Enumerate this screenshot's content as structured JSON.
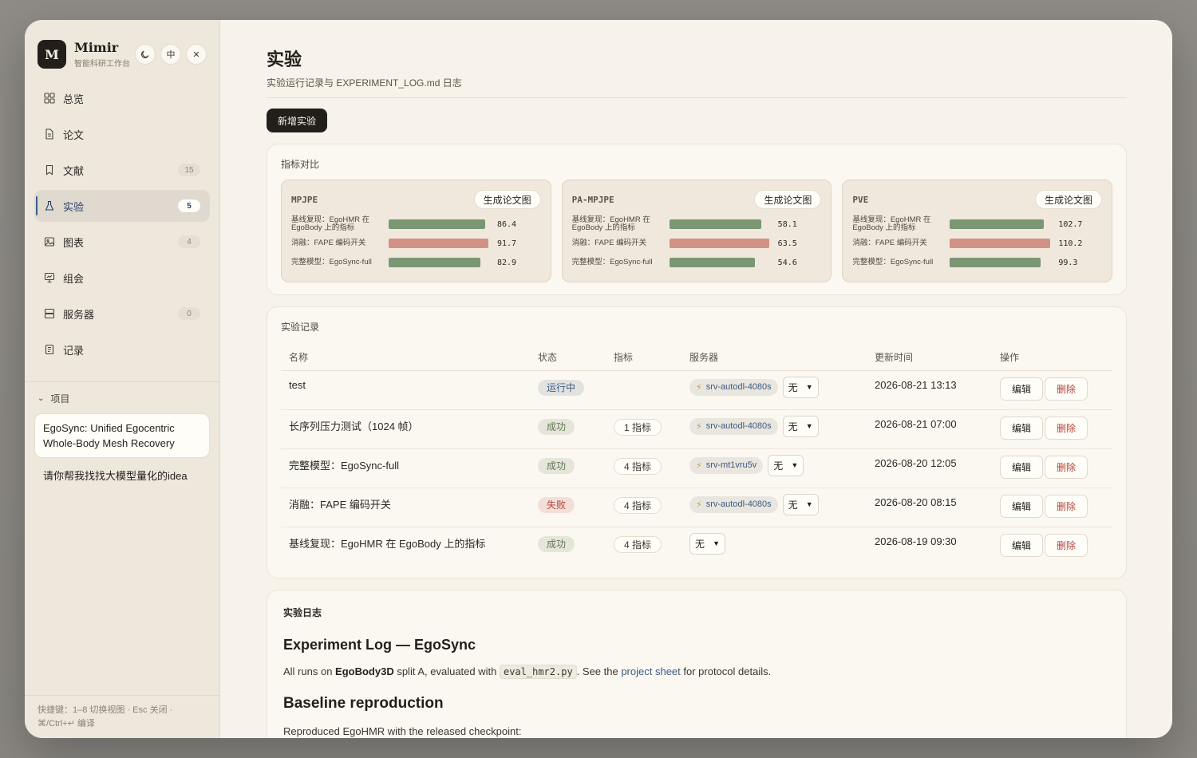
{
  "app": {
    "name": "Mimir",
    "subtitle": "智能科研工作台",
    "logo": "M"
  },
  "header_buttons": [
    {
      "icon": "moon-icon",
      "label": ""
    },
    {
      "icon": "language-toggle",
      "label": "中"
    },
    {
      "icon": "close-icon",
      "label": "✕"
    }
  ],
  "nav": [
    {
      "label": "总览",
      "icon": "grid-icon",
      "badge": ""
    },
    {
      "label": "论文",
      "icon": "document-icon",
      "badge": ""
    },
    {
      "label": "文献",
      "icon": "bookmark-icon",
      "badge": "15"
    },
    {
      "label": "实验",
      "icon": "flask-icon",
      "badge": "5",
      "active": true
    },
    {
      "label": "图表",
      "icon": "image-icon",
      "badge": "4"
    },
    {
      "label": "组会",
      "icon": "presentation-icon",
      "badge": ""
    },
    {
      "label": "服务器",
      "icon": "server-icon",
      "badge": "0"
    },
    {
      "label": "记录",
      "icon": "notes-icon",
      "badge": ""
    }
  ],
  "projects": {
    "heading": "项目",
    "current": "EgoSync: Unified Egocentric Whole-Body Mesh Recovery",
    "other": "请你帮我找找大模型量化的idea"
  },
  "shortcut_hint": "快捷键：1–8 切换视图 · Esc 关闭 · ⌘/Ctrl+↵ 编译",
  "page": {
    "title": "实验",
    "subtitle": "实验运行记录与 EXPERIMENT_LOG.md 日志",
    "new_button": "新增实验"
  },
  "metrics": {
    "section_title": "指标对比",
    "gen_button": "生成论文图",
    "colors": {
      "good": "#7a9673",
      "bad": "#d29185"
    },
    "cards": [
      {
        "name": "MPJPE",
        "rows": [
          {
            "label": "基线复现：EgoHMR 在 EgoBody 上的指标",
            "value": "86.4",
            "fill": 0.945,
            "bad": false
          },
          {
            "label": "消融：FAPE 编码开关",
            "value": "91.7",
            "fill": 0.98,
            "bad": true
          },
          {
            "label": "完整模型：EgoSync-full",
            "value": "82.9",
            "fill": 0.9,
            "bad": false
          }
        ]
      },
      {
        "name": "PA-MPJPE",
        "rows": [
          {
            "label": "基线复现：EgoHMR 在 EgoBody 上的指标",
            "value": "58.1",
            "fill": 0.9,
            "bad": false
          },
          {
            "label": "消融：FAPE 编码开关",
            "value": "63.5",
            "fill": 0.98,
            "bad": true
          },
          {
            "label": "完整模型：EgoSync-full",
            "value": "54.6",
            "fill": 0.84,
            "bad": false
          }
        ]
      },
      {
        "name": "PVE",
        "rows": [
          {
            "label": "基线复现：EgoHMR 在 EgoBody 上的指标",
            "value": "102.7",
            "fill": 0.92,
            "bad": false
          },
          {
            "label": "消融：FAPE 编码开关",
            "value": "110.2",
            "fill": 0.98,
            "bad": true
          },
          {
            "label": "完整模型：EgoSync-full",
            "value": "99.3",
            "fill": 0.89,
            "bad": false
          }
        ]
      }
    ]
  },
  "records": {
    "section_title": "实验记录",
    "columns": [
      "名称",
      "状态",
      "指标",
      "服务器",
      "更新时间",
      "操作"
    ],
    "edit_label": "编辑",
    "delete_label": "删除",
    "select_none": "无",
    "rows": [
      {
        "name": "test",
        "status": "运行中",
        "status_type": "running",
        "metrics": "",
        "server": "srv-autodl-4080s",
        "time": "2026-08-21 13:13"
      },
      {
        "name": "长序列压力测试（1024 帧）",
        "status": "成功",
        "status_type": "success",
        "metrics": "1 指标",
        "server": "srv-autodl-4080s",
        "time": "2026-08-21 07:00"
      },
      {
        "name": "完整模型：EgoSync-full",
        "status": "成功",
        "status_type": "success",
        "metrics": "4 指标",
        "server": "srv-mt1vru5v",
        "time": "2026-08-20 12:05"
      },
      {
        "name": "消融：FAPE 编码开关",
        "status": "失败",
        "status_type": "fail",
        "metrics": "4 指标",
        "server": "srv-autodl-4080s",
        "time": "2026-08-20 08:15"
      },
      {
        "name": "基线复现：EgoHMR 在 EgoBody 上的指标",
        "status": "成功",
        "status_type": "success",
        "metrics": "4 指标",
        "server": "",
        "time": "2026-08-19 09:30"
      }
    ]
  },
  "log": {
    "section_title": "实验日志",
    "h1": "Experiment Log — EgoSync",
    "p1_before": "All runs on ",
    "p1_bold": "EgoBody3D",
    "p1_mid": " split A, evaluated with ",
    "p1_code": "eval_hmr2.py",
    "p1_after_code": ". See the ",
    "p1_link": "project sheet",
    "p1_end": " for protocol details.",
    "h2": "Baseline reproduction",
    "p2": "Reproduced EgoHMR with the released checkpoint:"
  }
}
